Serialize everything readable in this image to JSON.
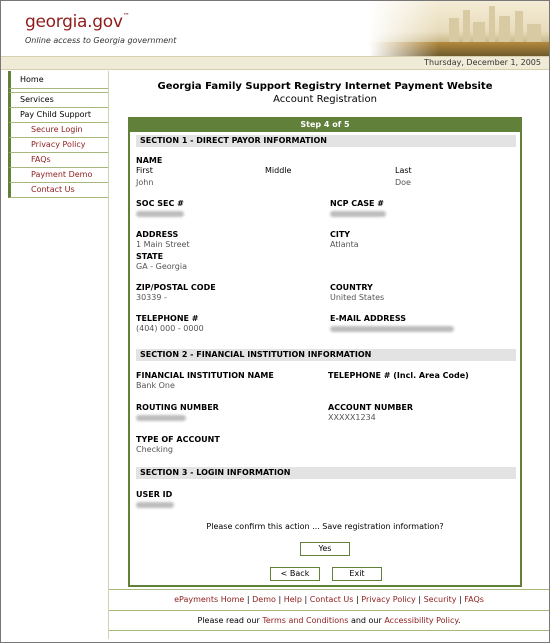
{
  "header": {
    "logo_text": "georgia.gov",
    "logo_tm": "™",
    "tagline": "Online access to Georgia government",
    "date": "Thursday, December 1, 2005"
  },
  "sidebar": {
    "items": [
      {
        "label": "Home"
      },
      {
        "label": "Services"
      },
      {
        "label": "Pay Child Support"
      },
      {
        "label": "Secure Login"
      },
      {
        "label": "Privacy Policy"
      },
      {
        "label": "FAQs"
      },
      {
        "label": "Payment Demo"
      },
      {
        "label": "Contact Us"
      }
    ]
  },
  "page": {
    "title": "Georgia Family Support Registry Internet Payment Website",
    "subtitle": "Account Registration",
    "step": "Step 4 of 5"
  },
  "section1": {
    "heading": "SECTION 1 - DIRECT PAYOR INFORMATION",
    "name_label": "NAME",
    "first_label": "First",
    "middle_label": "Middle",
    "last_label": "Last",
    "first_value": "John",
    "last_value": "Doe",
    "ssn_label": "SOC SEC #",
    "ncp_label": "NCP CASE #",
    "address_label": "ADDRESS",
    "address_value": "1 Main Street",
    "city_label": "CITY",
    "city_value": "Atlanta",
    "state_label": "STATE",
    "state_value": "GA - Georgia",
    "zip_label": "ZIP/POSTAL CODE",
    "zip_value": "30339 -",
    "country_label": "COUNTRY",
    "country_value": "United States",
    "phone_label": "TELEPHONE #",
    "phone_value": "(404) 000 - 0000",
    "email_label": "E-MAIL ADDRESS"
  },
  "section2": {
    "heading": "SECTION 2 - FINANCIAL INSTITUTION INFORMATION",
    "fi_name_label": "FINANCIAL INSTITUTION NAME",
    "fi_name_value": "Bank One",
    "fi_phone_label": "TELEPHONE # (Incl. Area Code)",
    "routing_label": "ROUTING NUMBER",
    "account_label": "ACCOUNT NUMBER",
    "account_value": "XXXXX1234",
    "type_label": "TYPE OF ACCOUNT",
    "type_value": "Checking"
  },
  "section3": {
    "heading": "SECTION 3 - LOGIN INFORMATION",
    "userid_label": "USER ID"
  },
  "actions": {
    "confirm_text": "Please confirm this action ... Save registration information?",
    "yes": "Yes",
    "back": "< Back",
    "exit": "Exit"
  },
  "footer": {
    "links": [
      "ePayments Home",
      "Demo",
      "Help",
      "Contact Us",
      "Privacy Policy",
      "Security",
      "FAQs"
    ],
    "separator": "|",
    "notice_prefix": "Please read our",
    "terms_link": "Terms and Conditions",
    "notice_and": "and our",
    "accessibility_link": "Accessibility Policy",
    "notice_suffix": "."
  },
  "colors": {
    "accent_green": "#61803a",
    "link_red": "#8e1c1c",
    "section_gray": "#e3e3e3"
  }
}
